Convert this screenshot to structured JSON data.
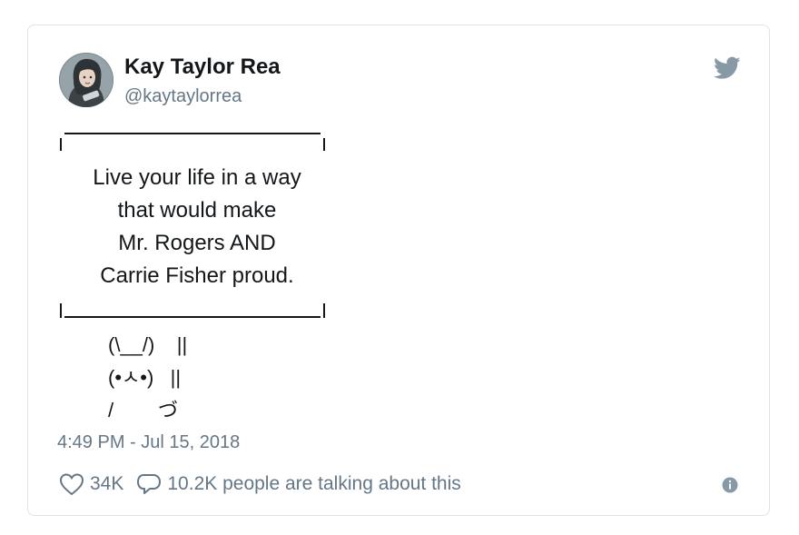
{
  "tweet": {
    "author_name": "Kay Taylor Rea",
    "author_handle": "@kaytaylorrea",
    "quote_lines": [
      "Live your life in a way",
      "that would make",
      "Mr. Rogers AND",
      "Carrie Fisher proud."
    ],
    "bunny_lines": [
      "(\\__/)    ||",
      "(•ㅅ•)   ||",
      "/        づ"
    ],
    "timestamp": "4:49 PM - Jul 15, 2018",
    "like_count": "34K",
    "reply_text": "10.2K people are talking about this"
  },
  "icons": {
    "brand": "twitter-bird-icon",
    "like": "heart-icon",
    "reply": "speech-bubble-icon",
    "info": "info-icon"
  },
  "colors": {
    "text_primary": "#14171a",
    "text_secondary": "#657786",
    "twitter_blue": "#8899a6",
    "border": "#dfe3e7"
  }
}
